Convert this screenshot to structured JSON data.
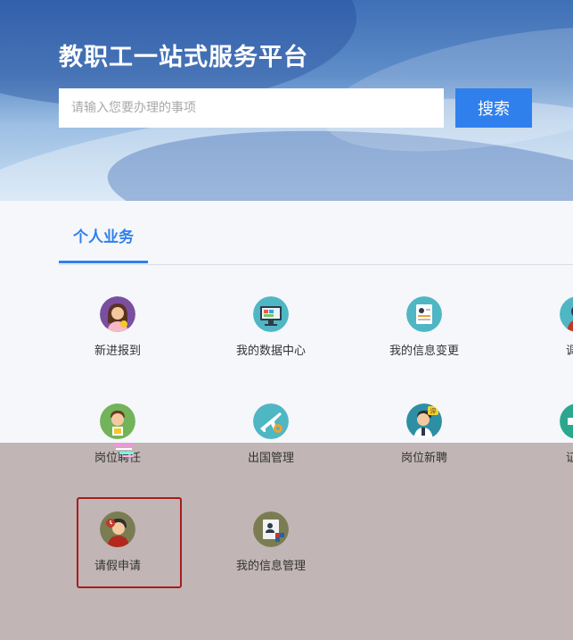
{
  "header": {
    "title": "教职工一站式服务平台",
    "search_placeholder": "请输入您要办理的事项",
    "search_button": "搜索"
  },
  "tabs": [
    {
      "label": "个人业务",
      "active": true
    }
  ],
  "services": [
    {
      "label": "新进报到",
      "icon": "new-staff-woman-icon",
      "color": "#7a4fa0"
    },
    {
      "label": "我的数据中心",
      "icon": "data-center-monitor-icon",
      "color": "#4fb6c4"
    },
    {
      "label": "我的信息变更",
      "icon": "info-change-document-icon",
      "color": "#4fb6c4"
    },
    {
      "label": "调动",
      "icon": "transfer-person-icon",
      "color": "#4fb6c4"
    },
    {
      "label": "岗位聘任",
      "icon": "post-appointment-man-icon",
      "color": "#73b35a"
    },
    {
      "label": "出国管理",
      "icon": "airplane-icon",
      "color": "#4fb6c4"
    },
    {
      "label": "岗位新聘",
      "icon": "new-hire-evaluate-icon",
      "color": "#2d8fa3"
    },
    {
      "label": "证明",
      "icon": "certificate-icon",
      "color": "#2aa78d"
    },
    {
      "label": "请假申请",
      "icon": "leave-request-clock-icon",
      "color": "#7a7d52"
    },
    {
      "label": "我的信息管理",
      "icon": "info-management-icon",
      "color": "#7a7d52"
    }
  ],
  "colors": {
    "accent": "#2f80ed",
    "highlight_border": "#a81c1c",
    "overlay": "#c1b5b5"
  }
}
